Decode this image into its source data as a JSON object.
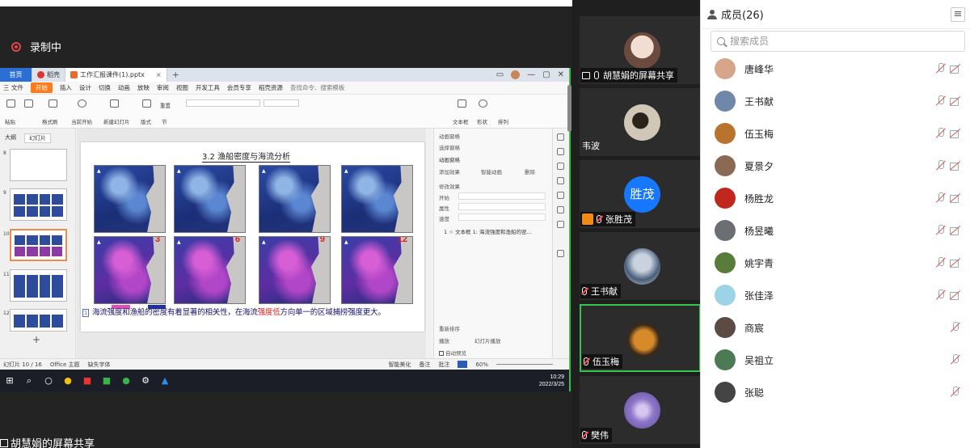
{
  "recording": {
    "label": "录制中"
  },
  "app_window": {
    "tabs": [
      {
        "label": "首页"
      },
      {
        "label": "稻壳"
      },
      {
        "label": "工作汇报课件(1).pptx"
      }
    ],
    "menu": [
      "三 文件",
      "开始",
      "插入",
      "设计",
      "切换",
      "动画",
      "放映",
      "审阅",
      "视图",
      "开发工具",
      "会员专享",
      "稻壳资源"
    ],
    "menu_search": "查找命令、搜索模板",
    "ribbon_labels": [
      "粘贴",
      "格式刷",
      "当前开始",
      "新建幻灯片",
      "版式",
      "节",
      "重置",
      "文本框",
      "形状",
      "排列"
    ],
    "panel_tabs": [
      "大纲",
      "幻灯片"
    ],
    "slide_numbers": [
      "8",
      "9",
      "10",
      "11",
      "12"
    ],
    "slide_title": "3.2 渔船密度与海流分析",
    "months": [
      "3",
      "6",
      "9",
      "12"
    ],
    "caption": {
      "index": "1",
      "before": "海流强度和渔船的密度有着显著的相关性，在海流",
      "highlight": "强度低",
      "after": "方向单一的区域捕捞强度更大。"
    },
    "anim_panel": {
      "title": "动画窗格",
      "select_pane": "选择窗格",
      "anim_title": "动画窗格",
      "add_effect": "添加效果",
      "smart_anim": "智能动画",
      "delete": "删除",
      "modify": "修改效果",
      "start": "开始",
      "property": "属性",
      "speed": "速度",
      "item": "1 ☆ 文本框 1: 海流强度和渔船的密...",
      "reorder": "重新排序",
      "play": "播放",
      "slideshow": "幻灯片播放",
      "autopreview": "自动预览"
    },
    "status": {
      "slide_count": "幻灯片 10 / 16",
      "theme": "Office 主题",
      "font_missing": "缺失字体",
      "beautify": "智能美化",
      "notes": "备注",
      "comments": "批注",
      "zoom": "60%"
    },
    "clock": {
      "time": "10:29",
      "date": "2022/3/25"
    }
  },
  "share_footer": {
    "label": "胡慧娟的屏幕共享"
  },
  "video_tiles": [
    {
      "name": "胡慧娟的屏幕共享",
      "avatar_color": "#e9d6cc",
      "type": "share"
    },
    {
      "name": "韦波",
      "avatar_color": "#5a4a3a",
      "type": "plain"
    },
    {
      "name": "张胜茂",
      "avatar_text": "胜茂",
      "avatar_color": "#1677ff",
      "type": "host"
    },
    {
      "name": "王书献",
      "avatar_color": "#7d93b0",
      "type": "mic"
    },
    {
      "name": "伍玉梅",
      "avatar_color": "#c57a25",
      "type": "mic"
    },
    {
      "name": "樊伟",
      "avatar_color": "#8f77c9",
      "type": "mic"
    }
  ],
  "members": {
    "title": "成员(26)",
    "search_placeholder": "搜索成员",
    "list": [
      {
        "name": "唐峰华",
        "avatar_color": "#d7a58a",
        "cam_off": true
      },
      {
        "name": "王书献",
        "avatar_color": "#6f87a8",
        "cam_off": true
      },
      {
        "name": "伍玉梅",
        "avatar_color": "#b8742e",
        "cam_off": true
      },
      {
        "name": "夏景夕",
        "avatar_color": "#8a6a55",
        "cam_off": true
      },
      {
        "name": "杨胜龙",
        "avatar_color": "#c0281e",
        "cam_off": true
      },
      {
        "name": "杨昱曦",
        "avatar_color": "#6b6f74",
        "cam_off": true
      },
      {
        "name": "姚宇青",
        "avatar_color": "#5a7c3a",
        "cam_off": true
      },
      {
        "name": "张佳泽",
        "avatar_color": "#9dd3e6",
        "cam_off": true
      },
      {
        "name": "商宸",
        "avatar_color": "#5b4b44",
        "cam_off": false
      },
      {
        "name": "吴祖立",
        "avatar_color": "#4c7a55",
        "cam_off": false
      },
      {
        "name": "张聪",
        "avatar_color": "#444444",
        "cam_off": false
      }
    ]
  }
}
